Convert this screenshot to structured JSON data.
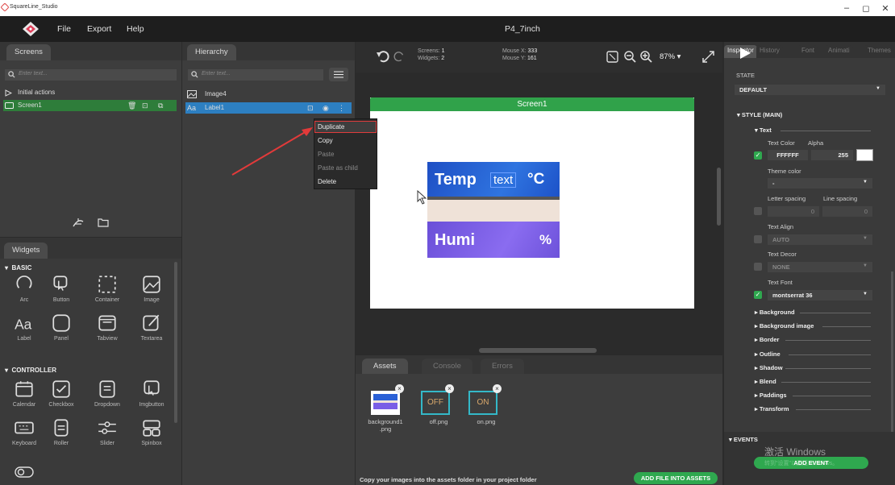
{
  "window": {
    "title": "SquareLine_Studio",
    "min": "–",
    "max": "◻",
    "close": "✕"
  },
  "menu": {
    "file": "File",
    "export": "Export",
    "help": "Help",
    "project_title": "P4_7inch"
  },
  "screens_panel": {
    "tab": "Screens",
    "search_placeholder": "Enter text...",
    "initial_actions": "Initial actions",
    "screen1": "Screen1"
  },
  "hierarchy": {
    "tab": "Hierarchy",
    "search_placeholder": "Enter text...",
    "items": [
      "Image4",
      "Label1"
    ]
  },
  "context_menu": {
    "duplicate": "Duplicate",
    "copy": "Copy",
    "paste": "Paste",
    "paste_as_child": "Paste as child",
    "delete": "Delete"
  },
  "widgets": {
    "tab": "Widgets",
    "basic_header": "BASIC",
    "basic": [
      "Arc",
      "Button",
      "Container",
      "Image",
      "Label",
      "Panel",
      "Tabview",
      "Textarea"
    ],
    "controller_header": "CONTROLLER",
    "controller": [
      "Calendar",
      "Checkbox",
      "Dropdown",
      "Imgbutton",
      "Keyboard",
      "Roller",
      "Slider",
      "Spinbox"
    ]
  },
  "toolbar": {
    "screens_label": "Screens:",
    "screens_val": "1",
    "widgets_label": "Widgets:",
    "widgets_val": "2",
    "mousex_label": "Mouse X:",
    "mousex_val": "333",
    "mousey_label": "Mouse Y:",
    "mousey_val": "161",
    "zoom": "87%"
  },
  "screen": {
    "title": "Screen1",
    "temp_label": "Temp",
    "temp_text": "text",
    "temp_unit": "°C",
    "humi_label": "Humi",
    "humi_unit": "%"
  },
  "bottom": {
    "tabs": [
      "Assets",
      "Console",
      "Errors"
    ],
    "assets": [
      "background1.png",
      "off.png",
      "on.png"
    ],
    "off_text": "OFF",
    "on_text": "ON",
    "footer": "Copy your images into the assets folder in your project folder",
    "add_file": "ADD FILE INTO ASSETS"
  },
  "inspector": {
    "tabs": [
      "Inspector",
      "History",
      "Font",
      "Animati",
      "Themes"
    ],
    "state_label": "STATE",
    "state_value": "DEFAULT",
    "style_header": "STYLE (MAIN)",
    "text_group": "Text",
    "text_color_label": "Text Color",
    "alpha_label": "Alpha",
    "text_color": "FFFFFF",
    "alpha": "255",
    "theme_color_label": "Theme color",
    "theme_color": "-",
    "letter_spacing_label": "Letter spacing",
    "line_spacing_label": "Line spacing",
    "letter_spacing": "0",
    "line_spacing": "0",
    "text_align_label": "Text Align",
    "text_align": "AUTO",
    "text_decor_label": "Text Decor",
    "text_decor": "NONE",
    "text_font_label": "Text Font",
    "text_font": "montserrat 36",
    "groups": [
      "Background",
      "Background image",
      "Border",
      "Outline",
      "Shadow",
      "Blend",
      "Paddings",
      "Transform"
    ],
    "events_header": "EVENTS",
    "add_event": "ADD EVENT",
    "watermark": "激活 Windows",
    "watermark2": "转到\"设置\"以激活 Windows。"
  }
}
